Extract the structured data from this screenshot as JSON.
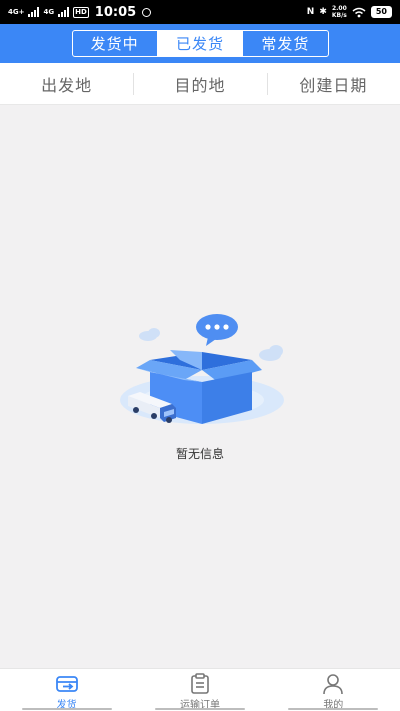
{
  "status_bar": {
    "net1": "4G+",
    "net2": "4G",
    "hd": "HD",
    "time": "10:05",
    "nfc": "N",
    "bluetooth": "✱",
    "speed_value": "2.00",
    "speed_unit": "KB/s",
    "battery": "50"
  },
  "header": {
    "tabs": [
      {
        "label": "发货中",
        "active": false
      },
      {
        "label": "已发货",
        "active": true
      },
      {
        "label": "常发货",
        "active": false
      }
    ]
  },
  "filters": [
    {
      "label": "出发地"
    },
    {
      "label": "目的地"
    },
    {
      "label": "创建日期"
    }
  ],
  "empty_state": {
    "message": "暂无信息"
  },
  "bottom_nav": {
    "items": [
      {
        "label": "发货",
        "icon": "ship-icon",
        "active": true
      },
      {
        "label": "运输订单",
        "icon": "clipboard-icon",
        "active": false
      },
      {
        "label": "我的",
        "icon": "user-icon",
        "active": false
      }
    ]
  },
  "colors": {
    "primary": "#3b87f6",
    "background": "#f2f1f2"
  }
}
